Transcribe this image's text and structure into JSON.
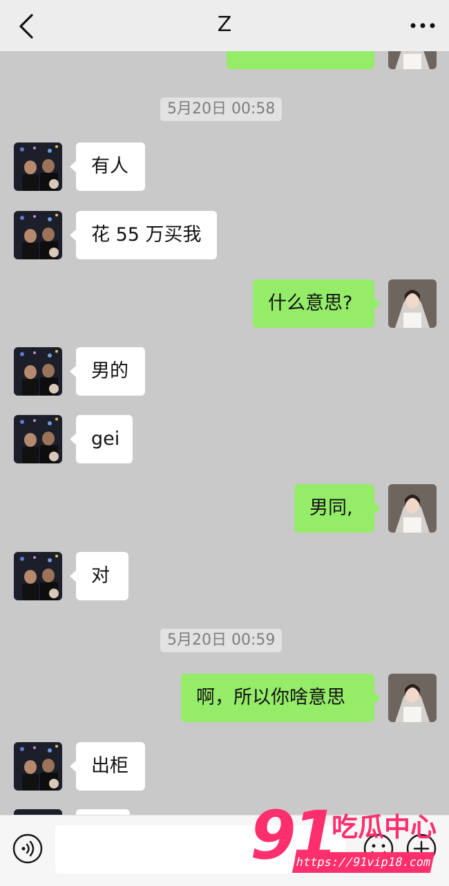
{
  "header": {
    "title": "Z",
    "back_icon": "chevron-left-icon",
    "more_icon": "more-dots-icon"
  },
  "chat": {
    "timestamps": [
      "5月20日 00:58",
      "5月20日 00:59"
    ],
    "messages": [
      {
        "side": "in",
        "text": "有人"
      },
      {
        "side": "in",
        "text": "花 55 万买我"
      },
      {
        "side": "out",
        "text": "什么意思?"
      },
      {
        "side": "in",
        "text": "男的"
      },
      {
        "side": "in",
        "text": "gei"
      },
      {
        "side": "out",
        "text": "男同,"
      },
      {
        "side": "in",
        "text": "对"
      },
      {
        "side": "out",
        "text": "啊，所以你啥意思"
      },
      {
        "side": "in",
        "text": "出柜"
      }
    ]
  },
  "input_bar": {
    "voice_icon": "voice-icon",
    "input_value": "",
    "emoji_icon": "emoji-icon",
    "plus_icon": "plus-icon"
  },
  "watermark": {
    "logo": "91",
    "name": "吃瓜中心",
    "url": "https://91vip18.com"
  },
  "colors": {
    "background": "#c9c9c9",
    "incoming_bubble": "#ffffff",
    "outgoing_bubble": "#95ec69",
    "header": "#ededed",
    "watermark": "#ff2f6d"
  }
}
